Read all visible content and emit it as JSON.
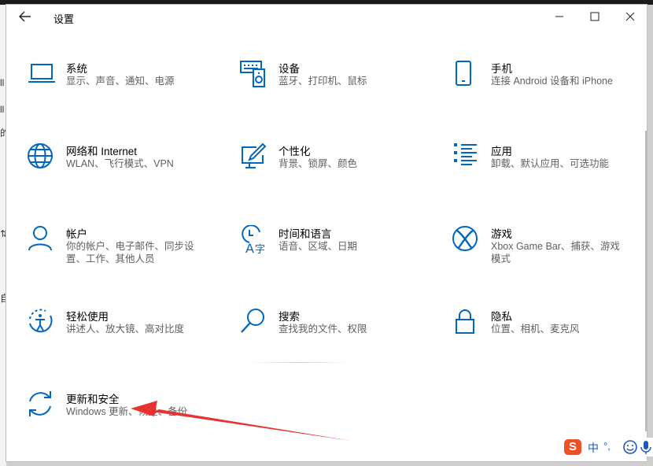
{
  "window": {
    "title": "设置"
  },
  "tiles": [
    {
      "name": "系统",
      "desc": "显示、声音、通知、电源",
      "icon": "laptop-icon"
    },
    {
      "name": "设备",
      "desc": "蓝牙、打印机、鼠标",
      "icon": "keyboard-speaker-icon"
    },
    {
      "name": "手机",
      "desc": "连接 Android 设备和 iPhone",
      "icon": "phone-icon"
    },
    {
      "name": "网络和 Internet",
      "desc": "WLAN、飞行模式、VPN",
      "icon": "globe-icon"
    },
    {
      "name": "个性化",
      "desc": "背景、锁屏、颜色",
      "icon": "paint-monitor-icon"
    },
    {
      "name": "应用",
      "desc": "卸载、默认应用、可选功能",
      "icon": "apps-list-icon"
    },
    {
      "name": "帐户",
      "desc": "你的帐户、电子邮件、同步设置、工作、其他人员",
      "icon": "person-icon"
    },
    {
      "name": "时间和语言",
      "desc": "语音、区域、日期",
      "icon": "time-language-icon"
    },
    {
      "name": "游戏",
      "desc": "Xbox Game Bar、捕获、游戏模式",
      "icon": "xbox-icon"
    },
    {
      "name": "轻松使用",
      "desc": "讲述人、放大镜、高对比度",
      "icon": "ease-of-access-icon"
    },
    {
      "name": "搜索",
      "desc": "查找我的文件、权限",
      "icon": "search-icon"
    },
    {
      "name": "隐私",
      "desc": "位置、相机、麦克风",
      "icon": "lock-icon"
    },
    {
      "name": "更新和安全",
      "desc": "Windows 更新、恢复、备份",
      "icon": "sync-icon"
    }
  ],
  "ime": {
    "logo": "S",
    "lang": "中",
    "punct": "°,"
  },
  "background_snippets": [
    "ll",
    "ll",
    "的",
    "⇅",
    "自"
  ],
  "colors": {
    "accent": "#0067c0",
    "arrow": "#e8322f",
    "ime_brand": "#ef4f25"
  }
}
